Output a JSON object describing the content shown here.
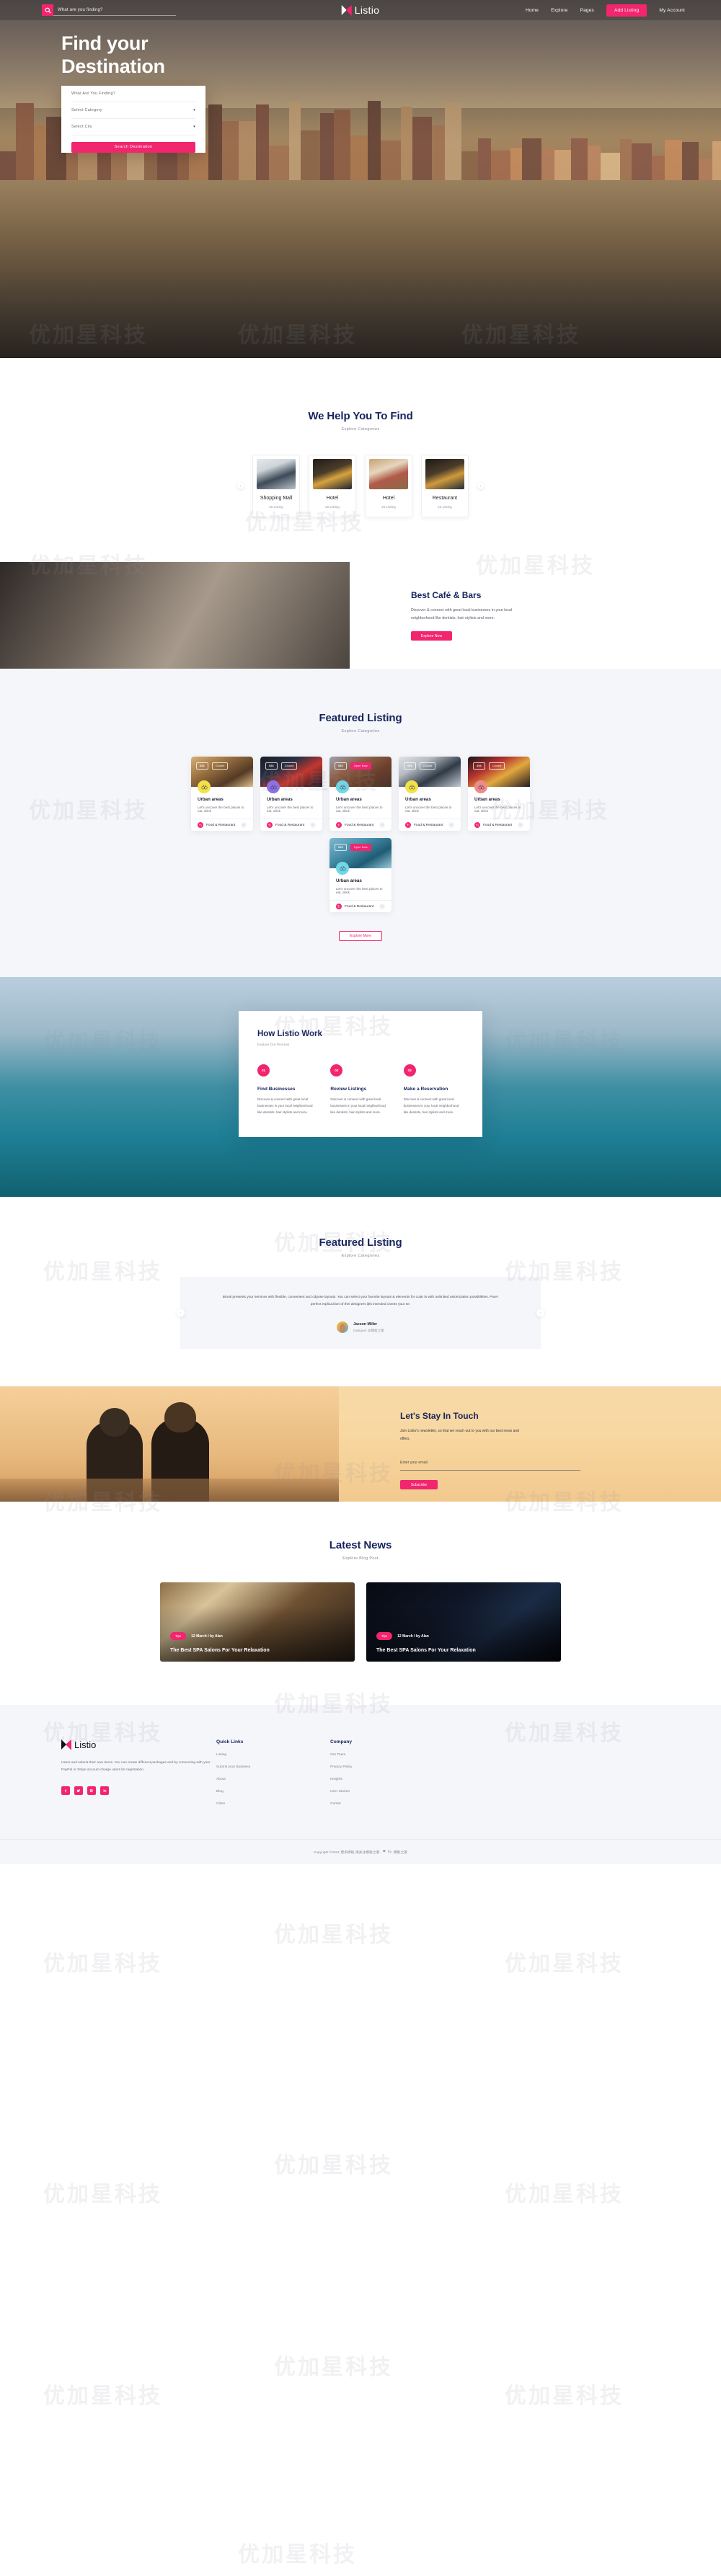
{
  "header": {
    "search_placeholder": "What are you finding?",
    "brand": "Listio",
    "nav": [
      {
        "label": "Home",
        "cta": false
      },
      {
        "label": "Explore",
        "cta": false
      },
      {
        "label": "Pages",
        "cta": false
      },
      {
        "label": "Add Listing",
        "cta": true
      },
      {
        "label": "My Account",
        "cta": false
      }
    ]
  },
  "hero": {
    "title_line1": "Find your",
    "title_line2": "Destination",
    "field_what": "What Are You Finding?",
    "field_category": "Select Category",
    "field_city": "Select City",
    "search_button": "Search Destination"
  },
  "categories": {
    "title": "We Help You To Find",
    "subtitle": "Explore Categories",
    "items": [
      {
        "name": "Shopping Mall",
        "count": "20 Listing"
      },
      {
        "name": "Hotel",
        "count": "20 Listing"
      },
      {
        "name": "Hotel",
        "count": "20 Listing"
      },
      {
        "name": "Restaurant",
        "count": "20 Listing"
      }
    ]
  },
  "cafe": {
    "title": "Best Café & Bars",
    "desc": "Discover & connect with great local businesses in your local neighborhood like dentists, hair stylists and more.",
    "button": "Explore Now"
  },
  "featured": {
    "title": "Featured Listing",
    "subtitle": "Explore Categories",
    "explore_more": "Explore More",
    "cards": [
      {
        "price": "$$$",
        "status": "Closed",
        "status_open": false,
        "title": "Urban areas",
        "desc": "Let's uncover the best places to eat, drink",
        "category": "Food & Restaurant",
        "avatar_color": "#f2e14a"
      },
      {
        "price": "$$$",
        "status": "Closed",
        "status_open": false,
        "title": "Urban areas",
        "desc": "Let's uncover the best places to eat, drink",
        "category": "Food & Restaurant",
        "avatar_color": "#8d6ee8"
      },
      {
        "price": "$$$",
        "status": "Open Now",
        "status_open": true,
        "title": "Urban areas",
        "desc": "Let's uncover the best places to eat, drink",
        "category": "Food & Restaurant",
        "avatar_color": "#6fd7e8"
      },
      {
        "price": "$$$",
        "status": "Closed",
        "status_open": false,
        "title": "Urban areas",
        "desc": "Let's uncover the best places to eat, drink",
        "category": "Food & Restaurant",
        "avatar_color": "#f2e14a"
      },
      {
        "price": "$$$",
        "status": "Closed",
        "status_open": false,
        "title": "Urban areas",
        "desc": "Let's uncover the best places to eat, drink",
        "category": "Food & Restaurant",
        "avatar_color": "#f08a8a"
      },
      {
        "price": "$$$",
        "status": "Open Now",
        "status_open": true,
        "title": "Urban areas",
        "desc": "Let's uncover the best places to eat, drink",
        "category": "Food & Restaurant",
        "avatar_color": "#6fd7e8"
      }
    ]
  },
  "how": {
    "title": "How Listio Work",
    "subtitle": "Explore Our Process",
    "steps": [
      {
        "num": "01",
        "title": "Find Businesses",
        "desc": "Discover & connect with great local businesses in your local neighborhood like dentists, hair stylists and more."
      },
      {
        "num": "02",
        "title": "Review Listings",
        "desc": "Discover & connect with great local businesses in your local neighborhood like dentists, hair stylists and more."
      },
      {
        "num": "03",
        "title": "Make a Reservation",
        "desc": "Discover & connect with great local businesses in your local neighborhood like dentists, hair stylists and more."
      }
    ]
  },
  "testimonial": {
    "title": "Featured Listing",
    "subtitle": "Explore Categories",
    "quote": "Brook presents your services with flexible, convenient and cdpose layouts. You can select your favorite layouts & elements for cular ts with unlimited ustomization possibilities. Pixel-perfect replica;ition of thei designers ijtls intended csents your se.",
    "name": "Jacson Miller",
    "role": "Designer @模板之家"
  },
  "newsletter": {
    "title": "Let's Stay In Touch",
    "desc": "Join Listio's newsletter, so that we reach out to you with our best news and offers.",
    "input_placeholder": "Enter your email",
    "button": "Subscribe"
  },
  "blog": {
    "title": "Latest News",
    "subtitle": "Explore Blog Post",
    "posts": [
      {
        "tag": "Tips",
        "meta": "12 March I by Alan",
        "title": "The Best SPA Salons For Your Relaxation"
      },
      {
        "tag": "Tips",
        "meta": "12 March I by Alan",
        "title": "The Best SPA Salons For Your Relaxation"
      }
    ]
  },
  "footer": {
    "brand": "Listio",
    "desc": "Users and submit their own items. You can create different packages and by connecting with your PayPal or Stripe account charge users for registration.",
    "social": [
      "facebook-icon",
      "twitter-icon",
      "pinterest-icon",
      "linkedin-icon"
    ],
    "columns": [
      {
        "heading": "Quick Links",
        "links": [
          "Listing",
          "Submit your Business",
          "About",
          "Blog",
          "Cities"
        ]
      },
      {
        "heading": "Company",
        "links": [
          "Our Team",
          "Privacy Policy",
          "Insights",
          "User Stories",
          "Carrier"
        ]
      }
    ],
    "copyright_pre": "Copyright ©2021 更多模板,请关注模板之家.",
    "copyright_by": "by",
    "copyright_link": "模板之家"
  },
  "colors": {
    "accent": "#f2256f",
    "navy": "#16235c"
  }
}
